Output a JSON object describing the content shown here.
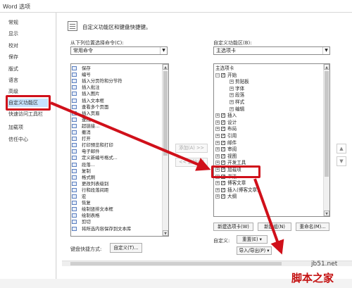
{
  "window": {
    "title": "Word 选项"
  },
  "sidebar": {
    "items": [
      {
        "label": "常规"
      },
      {
        "label": "显示"
      },
      {
        "label": "校对"
      },
      {
        "label": "保存"
      },
      {
        "label": "版式"
      },
      {
        "label": "语言"
      },
      {
        "label": "高级"
      },
      {
        "label": "自定义功能区"
      },
      {
        "label": "快速访问工具栏"
      },
      {
        "label": "加载项"
      },
      {
        "label": "信任中心"
      }
    ],
    "active": "自定义功能区"
  },
  "header": {
    "text": "自定义功能区和键盘快捷键。"
  },
  "left": {
    "label": "从下列位置选择命令(C):",
    "select_value": "常用命令",
    "commands": [
      {
        "label": "保存"
      },
      {
        "label": "编号",
        "sub": "▶"
      },
      {
        "label": "插入分页符和分节符",
        "sub": "▶"
      },
      {
        "label": "插入批注"
      },
      {
        "label": "插入图片"
      },
      {
        "label": "插入文本框",
        "sub": "▶"
      },
      {
        "label": "查看多个页面"
      },
      {
        "label": "插入页眉"
      },
      {
        "label": "查找"
      },
      {
        "label": "超链接..."
      },
      {
        "label": "撤消",
        "sub": "▶"
      },
      {
        "label": "打开"
      },
      {
        "label": "打印预览和打印"
      },
      {
        "label": "电子邮件"
      },
      {
        "label": "定义新编号格式..."
      },
      {
        "label": "段落..."
      },
      {
        "label": "复制"
      },
      {
        "label": "格式刷"
      },
      {
        "label": "更改列表级别",
        "sub": "▶"
      },
      {
        "label": "行和段落间距",
        "sub": "▶"
      },
      {
        "label": "宏"
      },
      {
        "label": "恢复"
      },
      {
        "label": "绘制竖排文本框"
      },
      {
        "label": "绘制表格"
      },
      {
        "label": "剪切"
      },
      {
        "label": "将所选内容保存到文本库"
      }
    ]
  },
  "middle": {
    "add_label": "添加(A) >>",
    "remove_label": "<< 删除(R)"
  },
  "right": {
    "label": "自定义功能区(B):",
    "select_value": "主选项卡",
    "tree": [
      {
        "label": "主选项卡",
        "level": 0,
        "exp": "",
        "chk": false,
        "header": true
      },
      {
        "label": "开始",
        "level": 0,
        "exp": "−",
        "chk": true
      },
      {
        "label": "剪贴板",
        "level": 2,
        "exp": "+",
        "chk": false
      },
      {
        "label": "字体",
        "level": 2,
        "exp": "+",
        "chk": false
      },
      {
        "label": "段落",
        "level": 2,
        "exp": "+",
        "chk": false
      },
      {
        "label": "样式",
        "level": 2,
        "exp": "+",
        "chk": false
      },
      {
        "label": "编辑",
        "level": 2,
        "exp": "+",
        "chk": false
      },
      {
        "label": "插入",
        "level": 0,
        "exp": "+",
        "chk": true
      },
      {
        "label": "设计",
        "level": 0,
        "exp": "+",
        "chk": true
      },
      {
        "label": "布局",
        "level": 0,
        "exp": "+",
        "chk": true
      },
      {
        "label": "引用",
        "level": 0,
        "exp": "+",
        "chk": true
      },
      {
        "label": "邮件",
        "level": 0,
        "exp": "+",
        "chk": true
      },
      {
        "label": "审阅",
        "level": 0,
        "exp": "+",
        "chk": true
      },
      {
        "label": "视图",
        "level": 0,
        "exp": "+",
        "chk": true
      },
      {
        "label": "开发工具",
        "level": 0,
        "exp": "+",
        "chk": true
      },
      {
        "label": "加载项",
        "level": 0,
        "exp": "+",
        "chk": true
      },
      {
        "label": "书法",
        "level": 0,
        "exp": "+",
        "chk": true
      },
      {
        "label": "博客文章",
        "level": 0,
        "exp": "+",
        "chk": true
      },
      {
        "label": "插入(博客文章)",
        "level": 0,
        "exp": "+",
        "chk": true
      },
      {
        "label": "大纲",
        "level": 0,
        "exp": "+",
        "chk": true
      }
    ],
    "new_tab_label": "新建选项卡(W)",
    "new_group_label": "新建组(N)",
    "rename_label": "重命名(M)...",
    "customize_label": "自定义:",
    "reset_label": "重置(E) ▾",
    "import_export_label": "导入/导出(P) ▾"
  },
  "keyboard": {
    "label": "键盘快捷方式:",
    "button_label": "自定义(T)..."
  },
  "move": {
    "up": "▲",
    "down": "▼"
  },
  "watermark": {
    "line1": "jb51.net",
    "line2": "脚本之家"
  },
  "colors": {
    "highlight_red": "#d0101a",
    "active_nav": "#c7e4ff"
  }
}
